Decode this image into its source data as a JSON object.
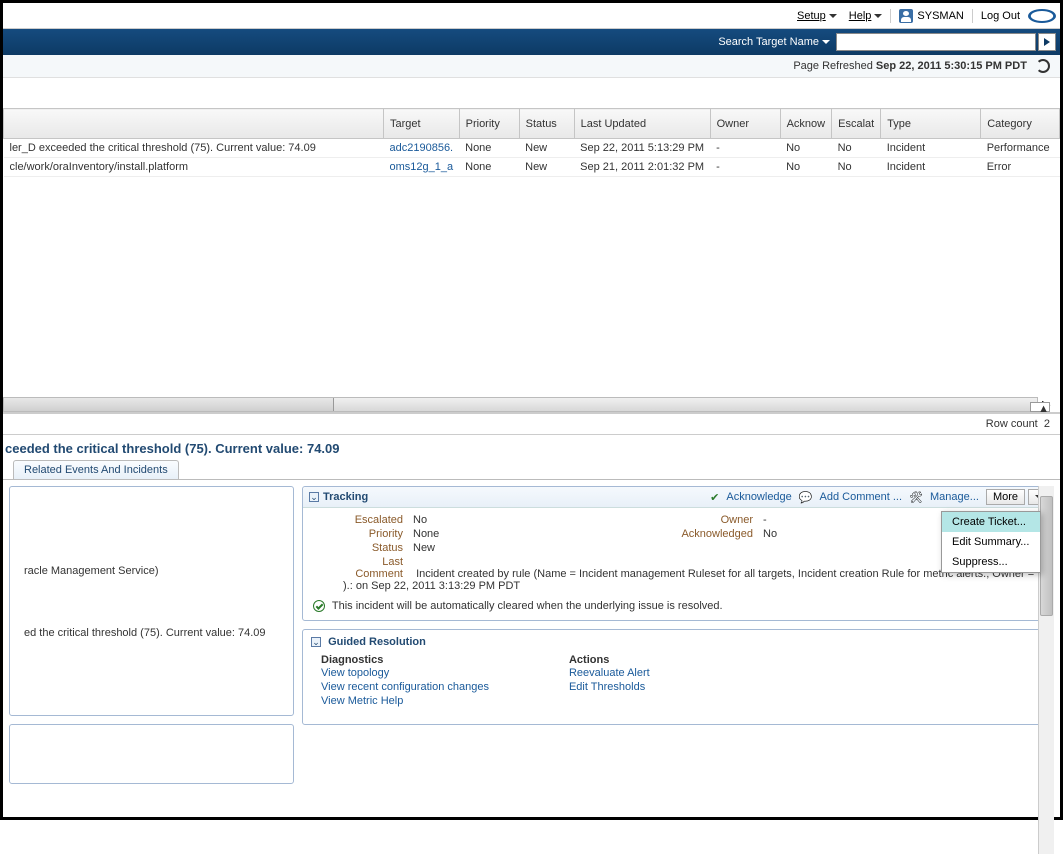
{
  "topbar": {
    "setup": "Setup",
    "help": "Help",
    "user": "SYSMAN",
    "logout": "Log Out"
  },
  "search": {
    "label": "Search Target Name",
    "value": ""
  },
  "refresh": {
    "prefix": "Page Refreshed ",
    "time": "Sep 22, 2011 5:30:15 PM PDT"
  },
  "columns": [
    "Target",
    "Priority",
    "Status",
    "Last Updated",
    "Owner",
    "Acknow",
    "Escalat",
    "Type",
    "Category"
  ],
  "rows": [
    {
      "summary": "ler_D exceeded the critical threshold (75). Current value: 74.09",
      "target": "adc2190856.",
      "priority": "None",
      "status": "New",
      "updated": "Sep 22, 2011 5:13:29 PM",
      "owner": "-",
      "ack": "No",
      "esc": "No",
      "type": "Incident",
      "category": "Performance"
    },
    {
      "summary": "cle/work/oraInventory/install.platform",
      "target": "oms12g_1_a",
      "priority": "None",
      "status": "New",
      "updated": "Sep 21, 2011 2:01:32 PM",
      "owner": "-",
      "ack": "No",
      "esc": "No",
      "type": "Incident",
      "category": "Error"
    }
  ],
  "row_count_label": "Row count",
  "row_count": "2",
  "detail_title": "ceeded the critical threshold (75). Current value: 74.09",
  "tab": "Related Events And Incidents",
  "left_panel": {
    "line1": "racle Management Service)",
    "line2": "ed the critical threshold (75). Current value: 74.09"
  },
  "tracking": {
    "title": "Tracking",
    "acknowledge": "Acknowledge",
    "add_comment": "Add Comment ...",
    "manage": "Manage...",
    "more": "More",
    "escalated_k": "Escalated",
    "escalated_v": "No",
    "priority_k": "Priority",
    "priority_v": "None",
    "status_k": "Status",
    "status_v": "New",
    "owner_k": "Owner",
    "owner_v": "-",
    "ack_k": "Acknowledged",
    "ack_v": "No",
    "lastcomment_k": "Last Comment",
    "lastcomment_v": "Incident created by rule (Name = Incident management Ruleset for all targets, Incident creation Rule for metric alerts.; Owner = ).: on Sep 22, 2011 3:13:29 PM PDT",
    "auto_clear": "This incident will be automatically cleared when the underlying issue is resolved."
  },
  "more_menu": {
    "create_ticket": "Create Ticket...",
    "edit_summary": "Edit Summary...",
    "suppress": "Suppress..."
  },
  "guided": {
    "title": "Guided Resolution",
    "diagnostics_hd": "Diagnostics",
    "view_topology": "View topology",
    "view_recent": "View recent configuration changes",
    "view_metric": "View Metric Help",
    "actions_hd": "Actions",
    "reeval": "Reevaluate Alert",
    "edit_thresh": "Edit Thresholds"
  }
}
